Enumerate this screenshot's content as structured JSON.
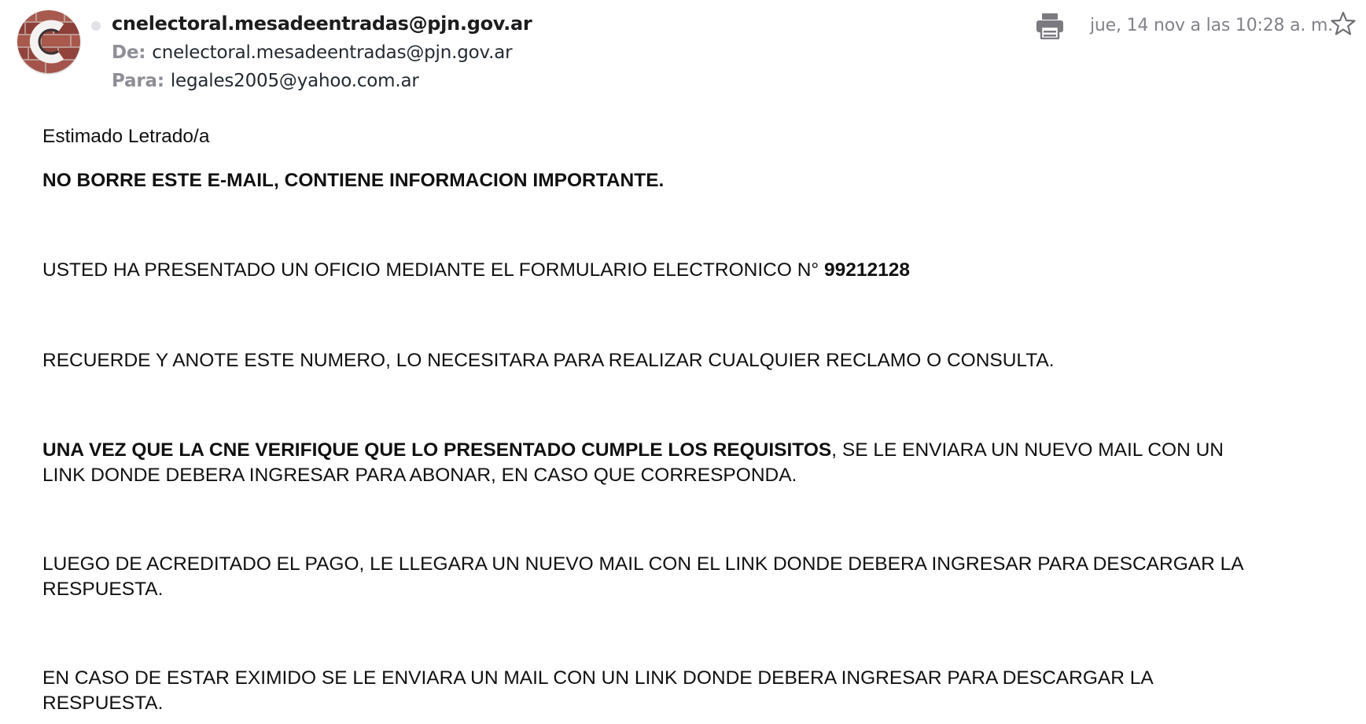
{
  "email": {
    "sender_name": "cnelectoral.mesadeentradas@pjn.gov.ar",
    "from_label": "De:",
    "from_address": "cnelectoral.mesadeentradas@pjn.gov.ar",
    "to_label": "Para:",
    "to_address": "legales2005@yahoo.com.ar",
    "date": "jue, 14 nov a las 10:28 a. m.",
    "icons": {
      "avatar": "sender-avatar",
      "status": "presence-dot",
      "print": "print-icon",
      "star": "star-icon"
    }
  },
  "message": {
    "greeting": "Estimado Letrado/a",
    "warning": "NO BORRE ESTE E-MAIL, CONTIENE INFORMACION IMPORTANTE.",
    "form_text": "USTED HA PRESENTADO UN OFICIO MEDIANTE EL FORMULARIO ELECTRONICO N° ",
    "form_number": "99212128",
    "reminder": "RECUERDE Y ANOTE ESTE NUMERO, LO NECESITARA PARA REALIZAR CUALQUIER RECLAMO O CONSULTA.",
    "verify_bold": "UNA VEZ QUE LA CNE VERIFIQUE QUE LO PRESENTADO CUMPLE LOS REQUISITOS",
    "verify_rest_1": ", SE LE ENVIARA UN NUEVO MAIL CON UN",
    "verify_rest_2": "LINK DONDE DEBERA INGRESAR PARA ABONAR, EN CASO QUE CORRESPONDA.",
    "payment_1": "LUEGO DE ACREDITADO EL PAGO, LE LLEGARA UN NUEVO MAIL CON EL LINK DONDE DEBERA INGRESAR PARA DESCARGAR LA",
    "payment_2": "RESPUESTA.",
    "exempt_1": "EN CASO DE ESTAR EXIMIDO SE LE ENVIARA UN MAIL CON UN LINK DONDE DEBERA INGRESAR PARA DESCARGAR LA",
    "exempt_2": "RESPUESTA."
  }
}
